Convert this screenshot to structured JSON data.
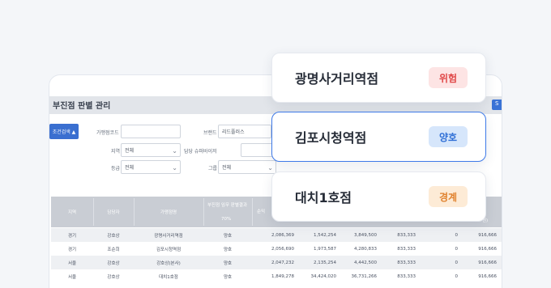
{
  "window": {
    "title": "부진점 판별 관리",
    "corner_button": "S",
    "search_button": "조건검색 ▲"
  },
  "filters": {
    "store_code_label": "가맹점코드",
    "brand_label": "브랜드",
    "brand_value": "리드플러스",
    "region_label": "지역",
    "region_value": "전체",
    "sv_label": "담당 슈퍼바이저",
    "grade_label": "등급",
    "grade_value": "전체",
    "group_label": "그룹",
    "group_value": "전체"
  },
  "table": {
    "headers": {
      "region": "지역",
      "manager": "담당자",
      "store": "가맹점명",
      "judge": "부진점 임무 판별결과",
      "judge_pct": "70%",
      "sales": "순익",
      "won": "원)"
    },
    "rows": [
      {
        "region": "경기",
        "manager": "강호상",
        "store": "광명사거리역점",
        "status": "양호",
        "v1": "2,086,369",
        "v2": "1,542,254",
        "v3": "3,849,500",
        "v4": "833,333",
        "v5": "0",
        "v6": "916,666"
      },
      {
        "region": "경기",
        "manager": "조순희",
        "store": "김포시청역점",
        "status": "양호",
        "v1": "2,056,690",
        "v2": "1,973,587",
        "v3": "4,280,833",
        "v4": "833,333",
        "v5": "0",
        "v6": "916,666"
      },
      {
        "region": "서울",
        "manager": "강호상",
        "store": "강호상(본사)",
        "status": "양호",
        "v1": "2,047,232",
        "v2": "2,135,254",
        "v3": "4,442,500",
        "v4": "833,333",
        "v5": "0",
        "v6": "916,666"
      },
      {
        "region": "서울",
        "manager": "강호상",
        "store": "대치1호점",
        "status": "양호",
        "v1": "1,849,278",
        "v2": "34,424,020",
        "v3": "36,731,266",
        "v4": "833,333",
        "v5": "0",
        "v6": "916,666"
      }
    ]
  },
  "cards": [
    {
      "name": "광명사거리역점",
      "status": "위험",
      "bg": "#fde4e4",
      "fg": "#e04848"
    },
    {
      "name": "김포시청역점",
      "status": "양호",
      "bg": "#d6e6fb",
      "fg": "#2f6fd6"
    },
    {
      "name": "대치1호점",
      "status": "경계",
      "bg": "#fdebd6",
      "fg": "#e0822e"
    }
  ],
  "colors": {
    "accent": "#3f7ae8",
    "header_bar": "#e2e5ea",
    "table_header": "#c9cdd4"
  }
}
